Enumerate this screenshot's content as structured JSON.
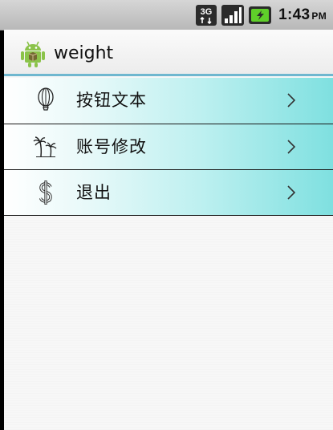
{
  "status_bar": {
    "network_label": "3G",
    "time": "1:43",
    "ampm": "PM",
    "icons": [
      "network-3g-icon",
      "signal-strength-icon",
      "battery-charging-icon"
    ]
  },
  "title_bar": {
    "app_icon": "android-logo-icon",
    "title": "weight"
  },
  "menu": {
    "items": [
      {
        "label": "按钮文本",
        "icon": "balloon-icon"
      },
      {
        "label": "账号修改",
        "icon": "palm-trees-icon"
      },
      {
        "label": "退出",
        "icon": "dollar-sign-icon"
      }
    ]
  },
  "colors": {
    "accent_line": "#6fb7cf",
    "item_gradient_end": "#7fe0e0"
  }
}
